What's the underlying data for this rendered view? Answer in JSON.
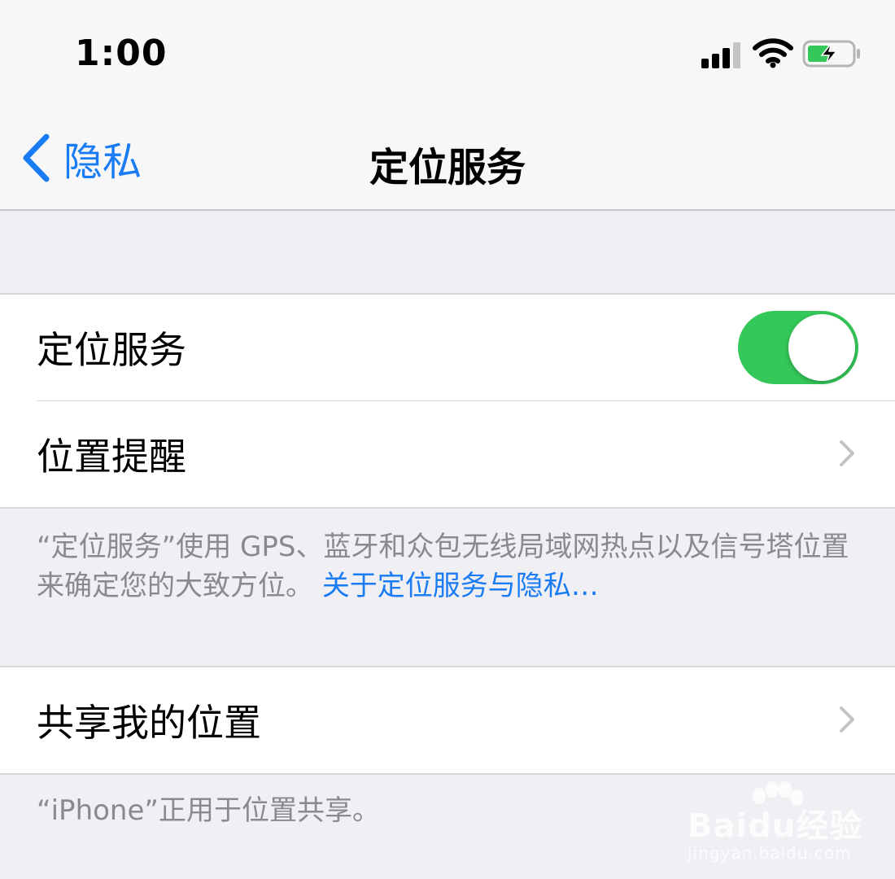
{
  "status_bar": {
    "time": "1:00",
    "signal_icon": "cellular-signal-icon",
    "wifi_icon": "wifi-icon",
    "battery_icon": "battery-charging-icon"
  },
  "nav": {
    "back_label": "隐私",
    "title": "定位服务"
  },
  "group1": {
    "location_services": {
      "label": "定位服务",
      "toggle_on": true
    },
    "location_alerts": {
      "label": "位置提醒"
    }
  },
  "footer1": {
    "text": "“定位服务”使用 GPS、蓝牙和众包无线局域网热点以及信号塔位置来确定您的大致方位。",
    "link": "关于定位服务与隐私…"
  },
  "group2": {
    "share_location": {
      "label": "共享我的位置"
    }
  },
  "footer2": {
    "text": "“iPhone”正用于位置共享。"
  },
  "watermark": {
    "brand": "Baidu经验",
    "url": "jingyan.baidu.com"
  },
  "colors": {
    "accent": "#1a7cf5",
    "toggle_on": "#34c759",
    "background": "#efeff4",
    "footer_text": "#8a8a8e"
  }
}
